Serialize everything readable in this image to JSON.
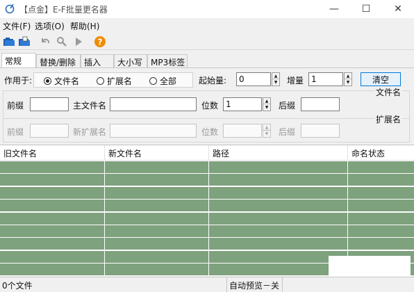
{
  "window": {
    "title": "【点金】E-F批量更名器",
    "controls": {
      "minimize": "—",
      "maximize": "☐",
      "close": "✕"
    }
  },
  "menu": [
    "文件(F)",
    "选项(O)",
    "帮助(H)"
  ],
  "toolbar": {
    "icons": [
      "open-folder-icon",
      "open-files-icon",
      "undo-icon",
      "search-icon",
      "run-icon",
      "help-icon"
    ]
  },
  "tabs": [
    {
      "label": "常规",
      "active": true
    },
    {
      "label": "替换/删除",
      "active": false
    },
    {
      "label": "插入",
      "active": false
    },
    {
      "label": "大小写",
      "active": false
    },
    {
      "label": "MP3标签",
      "active": false
    }
  ],
  "general": {
    "apply_to_label": "作用于:",
    "radio_options": [
      {
        "label": "文件名",
        "checked": true
      },
      {
        "label": "扩展名",
        "checked": false
      },
      {
        "label": "全部",
        "checked": false
      }
    ],
    "start_label": "起始量:",
    "start_value": "0",
    "increment_label": "增量",
    "increment_value": "1",
    "clear_button": "清空",
    "filename_group": {
      "title": "文件名",
      "prefix_label": "前缀",
      "prefix_value": "",
      "main_label": "主文件名",
      "main_value": "",
      "digits_label": "位数",
      "digits_value": "1",
      "suffix_label": "后缀",
      "suffix_value": ""
    },
    "extension_group": {
      "title": "扩展名",
      "prefix_label": "前缀",
      "prefix_value": "",
      "new_ext_label": "新扩展名",
      "new_ext_value": "",
      "digits_label": "位数",
      "digits_value": "",
      "suffix_label": "后缀",
      "suffix_value": ""
    }
  },
  "table": {
    "columns": [
      "旧文件名",
      "新文件名",
      "路径",
      "命名状态"
    ],
    "row_color": "#7ea17e",
    "empty_rows": 9
  },
  "status": {
    "file_count": "0个文件",
    "auto_preview": "自动预览－关"
  },
  "colors": {
    "accent": "#0078d7",
    "help_icon": "#f08c00"
  }
}
